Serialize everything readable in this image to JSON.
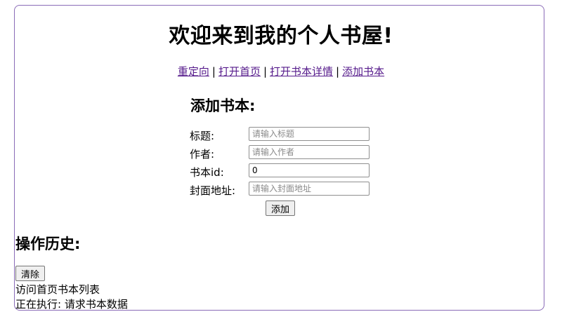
{
  "page": {
    "title": "欢迎来到我的个人书屋!"
  },
  "nav": {
    "links": [
      "重定向",
      "打开首页",
      "打开书本详情",
      "添加书本"
    ],
    "separator": "|"
  },
  "add_form": {
    "title": "添加书本:",
    "fields": [
      {
        "label": "标题:",
        "value": "",
        "placeholder": "请输入标题"
      },
      {
        "label": "作者:",
        "value": "",
        "placeholder": "请输入作者"
      },
      {
        "label": "书本id:",
        "value": "0",
        "placeholder": ""
      },
      {
        "label": "封面地址:",
        "value": "",
        "placeholder": "请输入封面地址"
      }
    ],
    "submit_label": "添加"
  },
  "history": {
    "title": "操作历史:",
    "clear_label": "清除",
    "entries": [
      "访问首页书本列表",
      "正在执行: 请求书本数据"
    ]
  },
  "colors": {
    "frame_border": "#8a6bb7",
    "link": "#551a8b"
  }
}
